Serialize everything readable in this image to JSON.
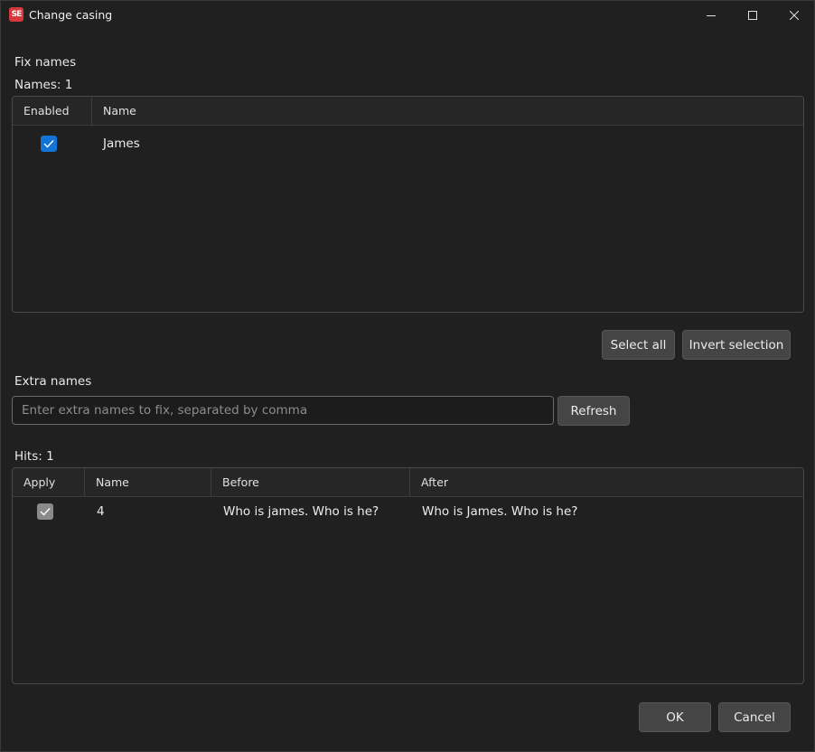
{
  "window": {
    "title": "Change casing",
    "app_icon_text": "SE"
  },
  "fix_names": {
    "section_label": "Fix names",
    "count_label": "Names: 1",
    "columns": [
      "Enabled",
      "Name"
    ],
    "rows": [
      {
        "enabled": true,
        "name": "James"
      }
    ]
  },
  "selection_buttons": {
    "select_all": "Select all",
    "invert_selection": "Invert selection"
  },
  "extra_names": {
    "label": "Extra names",
    "value": "",
    "placeholder": "Enter extra names to fix, separated by comma",
    "refresh": "Refresh"
  },
  "hits": {
    "count_label": "Hits: 1",
    "columns": [
      "Apply",
      "Name",
      "Before",
      "After"
    ],
    "rows": [
      {
        "apply": true,
        "name": "4",
        "before": "Who is james. Who is he?",
        "after": "Who is James. Who is he?"
      }
    ]
  },
  "footer": {
    "ok": "OK",
    "cancel": "Cancel"
  },
  "colors": {
    "background": "#202020",
    "checkbox_checked_accent": "#1473d6",
    "button": "#454545"
  }
}
